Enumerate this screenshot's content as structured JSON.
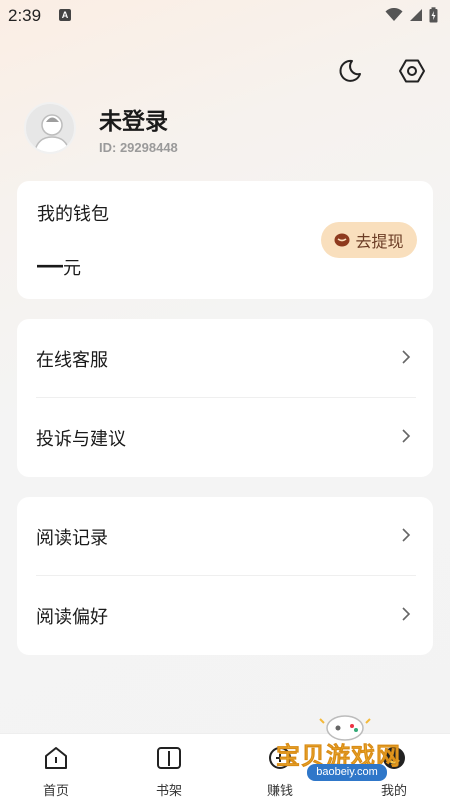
{
  "status_bar": {
    "time": "2:39",
    "a_badge": "A"
  },
  "top_actions": {
    "night_mode_icon": "moon-icon",
    "settings_icon": "hexagon-gear-icon"
  },
  "profile": {
    "name": "未登录",
    "id_label": "ID: 29298448"
  },
  "wallet": {
    "title": "我的钱包",
    "amount": "—",
    "unit": "元",
    "withdraw_label": "去提现",
    "accent": "#f9dfbd"
  },
  "menu_group_1": [
    {
      "label": "在线客服"
    },
    {
      "label": "投诉与建议"
    }
  ],
  "menu_group_2": [
    {
      "label": "阅读记录"
    },
    {
      "label": "阅读偏好"
    }
  ],
  "bottom_nav": [
    {
      "label": "首页",
      "icon": "home-icon"
    },
    {
      "label": "书架",
      "icon": "book-icon"
    },
    {
      "label": "赚钱",
      "icon": "coin-icon"
    },
    {
      "label": "我的",
      "icon": "user-icon"
    }
  ],
  "watermark": {
    "text": "宝贝游戏网",
    "url": "baobeiy.com"
  }
}
